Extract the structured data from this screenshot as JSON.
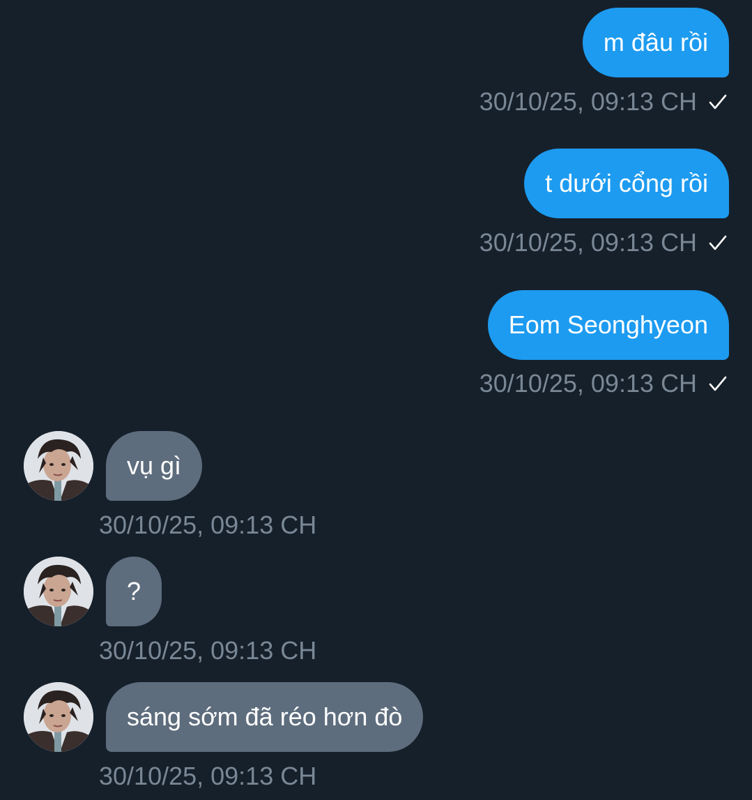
{
  "messages": [
    {
      "direction": "outgoing",
      "text": "m đâu rồi",
      "timestamp": "30/10/25, 09:13 CH",
      "status": "sent"
    },
    {
      "direction": "outgoing",
      "text": "t dưới cổng rồi",
      "timestamp": "30/10/25, 09:13 CH",
      "status": "sent"
    },
    {
      "direction": "outgoing",
      "text": "Eom Seonghyeon",
      "timestamp": "30/10/25, 09:13 CH",
      "status": "sent"
    },
    {
      "direction": "incoming",
      "text": "vụ gì",
      "timestamp": "30/10/25, 09:13 CH",
      "avatar": "user-avatar"
    },
    {
      "direction": "incoming",
      "text": "?",
      "timestamp": "30/10/25, 09:13 CH",
      "avatar": "user-avatar"
    },
    {
      "direction": "incoming",
      "text": "sáng sớm đã réo hơn đò",
      "timestamp": "30/10/25, 09:13 CH",
      "avatar": "user-avatar"
    }
  ],
  "colors": {
    "background": "#16202b",
    "outgoing_bubble": "#1d9bf0",
    "incoming_bubble": "#5e6d7d",
    "timestamp": "#7a8896"
  },
  "icons": {
    "sent_status": "checkmark-icon"
  }
}
